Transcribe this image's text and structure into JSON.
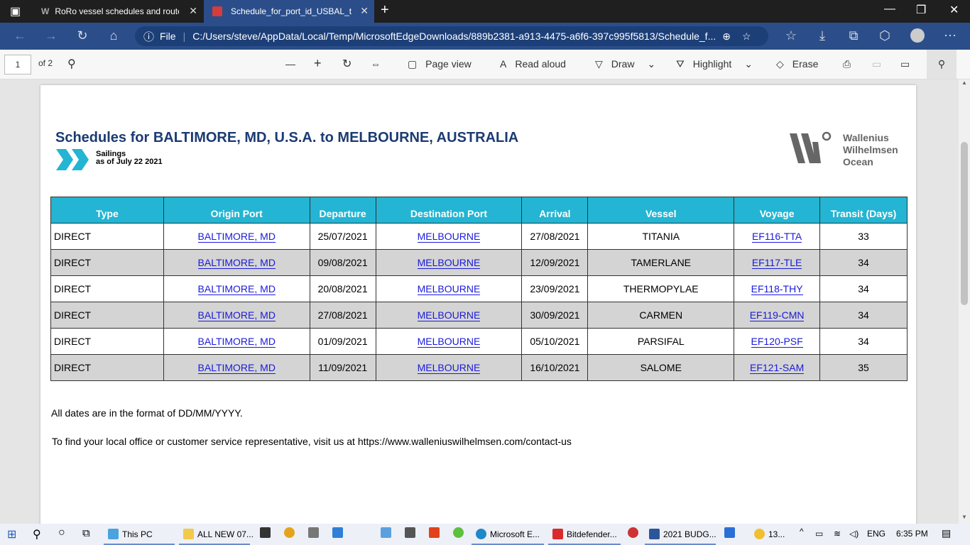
{
  "browser": {
    "tabs": [
      {
        "label": "RoRo vessel schedules and route"
      },
      {
        "label": "Schedule_for_port_id_USBAL_to_"
      }
    ],
    "file_label": "File",
    "url": "C:/Users/steve/AppData/Local/Temp/MicrosoftEdgeDownloads/889b2381-a913-4475-a6f6-397c995f5813/Schedule_f..."
  },
  "pdf_toolbar": {
    "page_number": "1",
    "page_count": "of 2",
    "page_view": "Page view",
    "read_aloud": "Read aloud",
    "draw": "Draw",
    "highlight": "Highlight",
    "erase": "Erase"
  },
  "document": {
    "title": "Schedules for BALTIMORE, MD, U.S.A. to MELBOURNE, AUSTRALIA",
    "subtitle_line1": "Sailings",
    "subtitle_line2": "as of July 22 2021",
    "logo_lines": [
      "Wallenius",
      "Wilhelmsen",
      "Ocean"
    ],
    "columns": [
      "Type",
      "Origin Port",
      "Departure",
      "Destination Port",
      "Arrival",
      "Vessel",
      "Voyage",
      "Transit (Days)"
    ],
    "rows": [
      [
        "DIRECT",
        "BALTIMORE, MD",
        "25/07/2021",
        "MELBOURNE",
        "27/08/2021",
        "TITANIA",
        "EF116-TTA",
        "33"
      ],
      [
        "DIRECT",
        "BALTIMORE, MD",
        "09/08/2021",
        "MELBOURNE",
        "12/09/2021",
        "TAMERLANE",
        "EF117-TLE",
        "34"
      ],
      [
        "DIRECT",
        "BALTIMORE, MD",
        "20/08/2021",
        "MELBOURNE",
        "23/09/2021",
        "THERMOPYLAE",
        "EF118-THY",
        "34"
      ],
      [
        "DIRECT",
        "BALTIMORE, MD",
        "27/08/2021",
        "MELBOURNE",
        "30/09/2021",
        "CARMEN",
        "EF119-CMN",
        "34"
      ],
      [
        "DIRECT",
        "BALTIMORE, MD",
        "01/09/2021",
        "MELBOURNE",
        "05/10/2021",
        "PARSIFAL",
        "EF120-PSF",
        "34"
      ],
      [
        "DIRECT",
        "BALTIMORE, MD",
        "11/09/2021",
        "MELBOURNE",
        "16/10/2021",
        "SALOME",
        "EF121-SAM",
        "35"
      ]
    ],
    "note1": "All dates are in the format of DD/MM/YYYY.",
    "note2": "To find your local office or customer service representative, visit us at https://www.walleniuswilhelmsen.com/contact-us"
  },
  "taskbar": {
    "items": [
      "This PC",
      "ALL NEW 07...",
      "Microsoft E...",
      "Bitdefender...",
      "2021 BUDG...",
      "13..."
    ],
    "lang": "ENG",
    "time": "6:35 PM"
  },
  "colors": {
    "header_cyan": "#23b5d3",
    "title_navy": "#1b3b72",
    "link_blue": "#1a1adb",
    "edge_blue": "#2b4e8a"
  }
}
